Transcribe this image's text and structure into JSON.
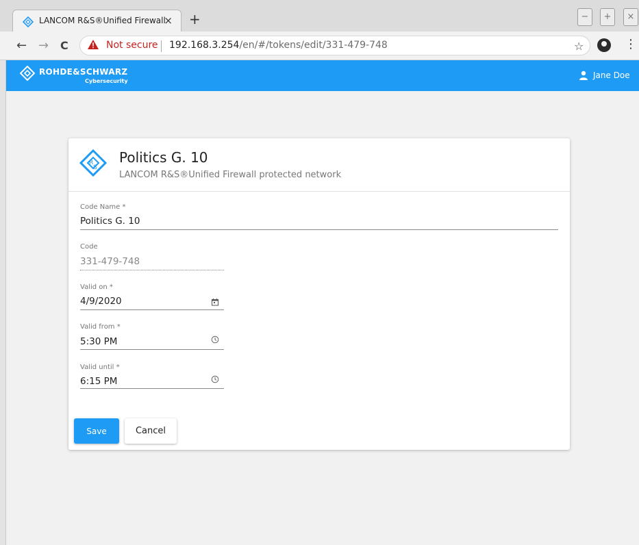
{
  "browser": {
    "tab_title": "LANCOM R&S®Unified Firewall",
    "tab_close": "×",
    "new_tab": "+",
    "window_buttons": [
      "−",
      "+",
      "×"
    ],
    "nav": {
      "back": "←",
      "forward": "→",
      "reload": "C"
    },
    "security_label": "Not secure",
    "url_host": "192.168.3.254",
    "url_path": "/en/#/tokens/edit/331-479-748",
    "bookmark": "☆",
    "menu": "⋮"
  },
  "appbar": {
    "brand": "ROHDE&SCHWARZ",
    "brand_sub": "Cybersecurity",
    "user_name": "Jane Doe",
    "color": "#1e9bf4"
  },
  "card": {
    "title": "Politics G. 10",
    "subtitle": "LANCOM R&S®Unified Firewall protected network"
  },
  "form": {
    "code_name_label": "Code Name *",
    "code_name_value": "Politics G. 10",
    "code_label": "Code",
    "code_value": "331-479-748",
    "valid_on_label": "Valid on *",
    "valid_on_value": "4/9/2020",
    "valid_from_label": "Valid from *",
    "valid_from_value": "5:30 PM",
    "valid_until_label": "Valid until *",
    "valid_until_value": "6:15 PM"
  },
  "actions": {
    "save_label": "Save",
    "cancel_label": "Cancel"
  },
  "icons": {
    "logo": "rs-diamond-icon",
    "user": "user-icon",
    "calendar": "calendar-icon",
    "clock": "clock-icon",
    "warning": "warning-icon"
  }
}
